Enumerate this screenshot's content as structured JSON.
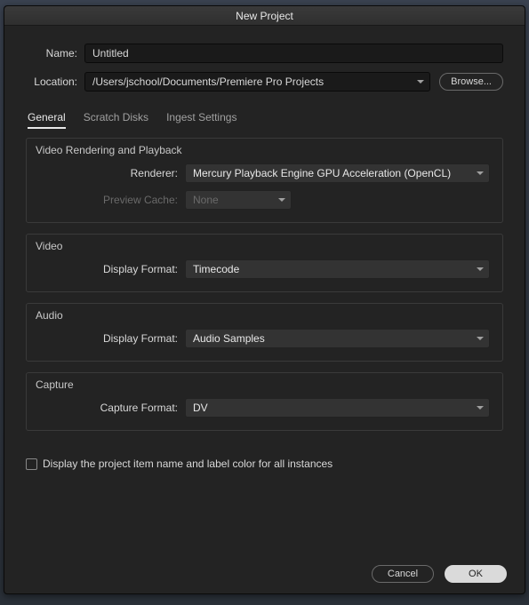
{
  "window": {
    "title": "New Project"
  },
  "form": {
    "name_label": "Name:",
    "name_value": "Untitled",
    "location_label": "Location:",
    "location_value": "/Users/jschool/Documents/Premiere Pro Projects",
    "browse_label": "Browse..."
  },
  "tabs": [
    {
      "label": "General",
      "active": true
    },
    {
      "label": "Scratch Disks",
      "active": false
    },
    {
      "label": "Ingest Settings",
      "active": false
    }
  ],
  "sections": {
    "rendering": {
      "legend": "Video Rendering and Playback",
      "renderer_label": "Renderer:",
      "renderer_value": "Mercury Playback Engine GPU Acceleration (OpenCL)",
      "preview_cache_label": "Preview Cache:",
      "preview_cache_value": "None"
    },
    "video": {
      "legend": "Video",
      "display_format_label": "Display Format:",
      "display_format_value": "Timecode"
    },
    "audio": {
      "legend": "Audio",
      "display_format_label": "Display Format:",
      "display_format_value": "Audio Samples"
    },
    "capture": {
      "legend": "Capture",
      "capture_format_label": "Capture Format:",
      "capture_format_value": "DV"
    }
  },
  "checkbox": {
    "label": "Display the project item name and label color for all instances",
    "checked": false
  },
  "footer": {
    "cancel": "Cancel",
    "ok": "OK"
  }
}
